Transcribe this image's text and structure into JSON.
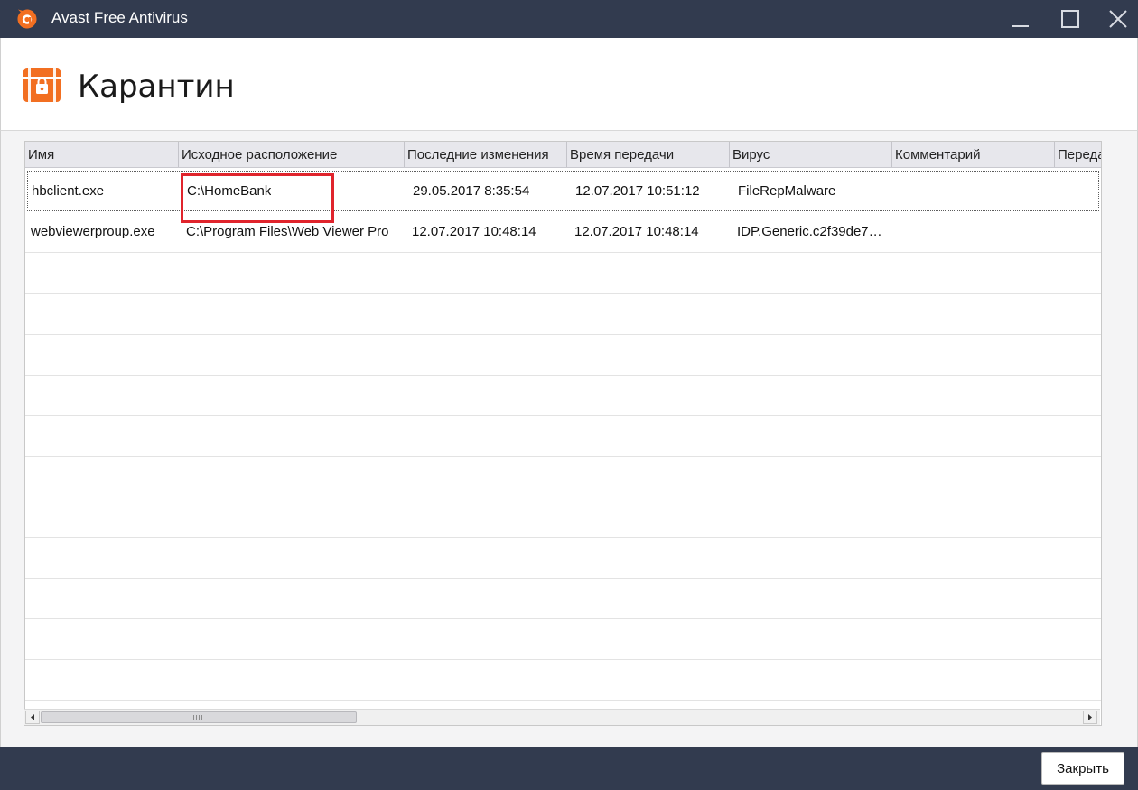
{
  "window": {
    "title": "Avast Free Antivirus",
    "colors": {
      "titlebar": "#323b4f",
      "accent": "#f26f21",
      "highlight": "#e0242c"
    }
  },
  "page": {
    "title": "Карантин",
    "icon": "quarantine-chest-icon"
  },
  "table": {
    "columns": [
      "Имя",
      "Исходное расположение",
      "Последние изменения",
      "Время передачи",
      "Вирус",
      "Комментарий",
      "Переда"
    ],
    "rows": [
      {
        "name": "hbclient.exe",
        "location": "C:\\HomeBank",
        "modified": "29.05.2017 8:35:54",
        "transferred": "12.07.2017 10:51:12",
        "virus": "FileRepMalware",
        "comment": ""
      },
      {
        "name": "webviewerproup.exe",
        "location": "C:\\Program Files\\Web Viewer Pro",
        "modified": "12.07.2017 10:48:14",
        "transferred": "12.07.2017 10:48:14",
        "virus": "IDP.Generic.c2f39de7…",
        "comment": ""
      }
    ]
  },
  "footer": {
    "close_label": "Закрыть"
  }
}
